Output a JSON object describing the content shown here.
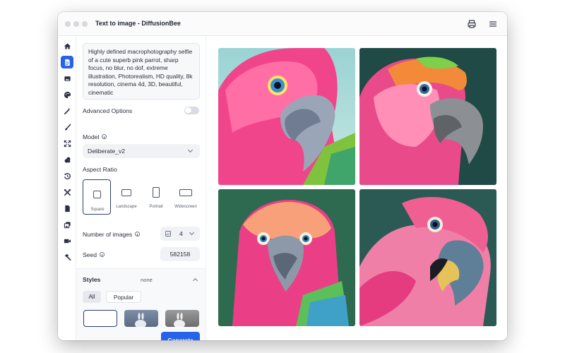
{
  "window": {
    "title": "Text to image - DiffusionBee"
  },
  "prompt": {
    "value": "Highly defined macrophotography selfie of a cute superb pink parrot, sharp focus, no blur, no dof, extreme illustration, Photorealism, HD quality, 8k resolution, cinema 4d, 3D, beautiful, cinematic"
  },
  "advanced": {
    "label": "Advanced Options",
    "enabled": false
  },
  "model": {
    "label": "Model",
    "value": "Deliberate_v2"
  },
  "aspect": {
    "label": "Aspect Ratio",
    "selected": "Square",
    "options": [
      "Square",
      "Landscape",
      "Portrait",
      "Widescreen"
    ]
  },
  "num_images": {
    "label": "Number of images",
    "value": "4"
  },
  "seed": {
    "label": "Seed",
    "value": "582158"
  },
  "styles": {
    "label": "Styles",
    "value": "none",
    "tabs": [
      "All",
      "Popular"
    ]
  },
  "generate": {
    "label": "Generate"
  },
  "sidebar": {
    "icons": [
      "home-icon",
      "text-to-image-icon",
      "image-icon",
      "palette-icon",
      "magic-wand-icon",
      "brush-icon",
      "expand-icon",
      "layers-icon",
      "history-icon",
      "tools-icon",
      "document-icon",
      "gallery-icon",
      "video-icon",
      "hammer-icon"
    ],
    "active_index": 1
  },
  "colors": {
    "accent": "#2563eb",
    "parrot_pink": "#f0458a",
    "bg_teal": "#2d5f57"
  }
}
